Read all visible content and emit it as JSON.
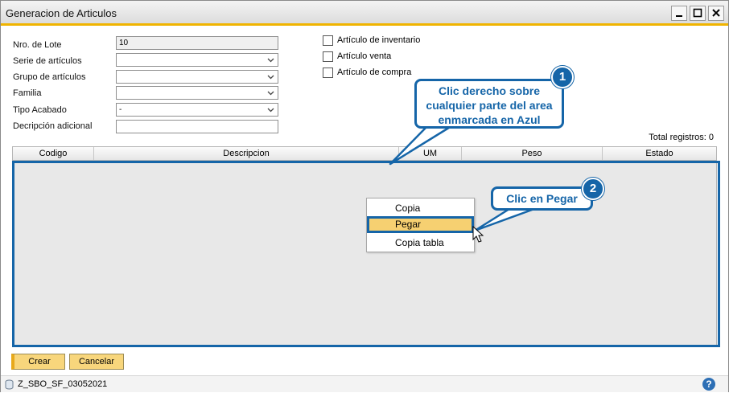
{
  "window": {
    "title": "Generacion de Articulos"
  },
  "form": {
    "lote_label": "Nro. de Lote",
    "lote_value": "10",
    "serie_label": "Serie de artículos",
    "serie_value": "",
    "grupo_label": "Grupo de artículos",
    "grupo_value": "",
    "familia_label": "Familia",
    "familia_value": "",
    "tipo_label": "Tipo Acabado",
    "tipo_value": "-",
    "desc_label": "Decripción adicional",
    "desc_value": ""
  },
  "checks": [
    {
      "label": "Artículo de inventario",
      "checked": false
    },
    {
      "label": "Artículo venta",
      "checked": false
    },
    {
      "label": "Artículo de compra",
      "checked": false
    }
  ],
  "grid": {
    "total": "Total registros: 0",
    "columns": [
      "Codigo",
      "Descripcion",
      "UM",
      "Peso",
      "Estado"
    ]
  },
  "context_menu": {
    "items": [
      "Copia",
      "Pegar",
      "Copia tabla"
    ],
    "highlighted": "Pegar"
  },
  "callouts": {
    "one": {
      "number": "1",
      "line1": "Clic derecho sobre",
      "line2": "cualquier parte del area",
      "line3": "enmarcada en Azul"
    },
    "two": {
      "number": "2",
      "text": "Clic en Pegar"
    }
  },
  "buttons": {
    "create": "Crear",
    "cancel": "Cancelar"
  },
  "status": {
    "db": "Z_SBO_SF_03052021",
    "help": "?"
  },
  "colors": {
    "accent": "#f0b400",
    "annotation": "#1565a8",
    "button": "#f8d67c"
  },
  "icons": [
    "minimize-icon",
    "maximize-icon",
    "close-icon",
    "chevron-down-icon",
    "database-icon",
    "help-icon",
    "mouse-cursor-icon"
  ]
}
